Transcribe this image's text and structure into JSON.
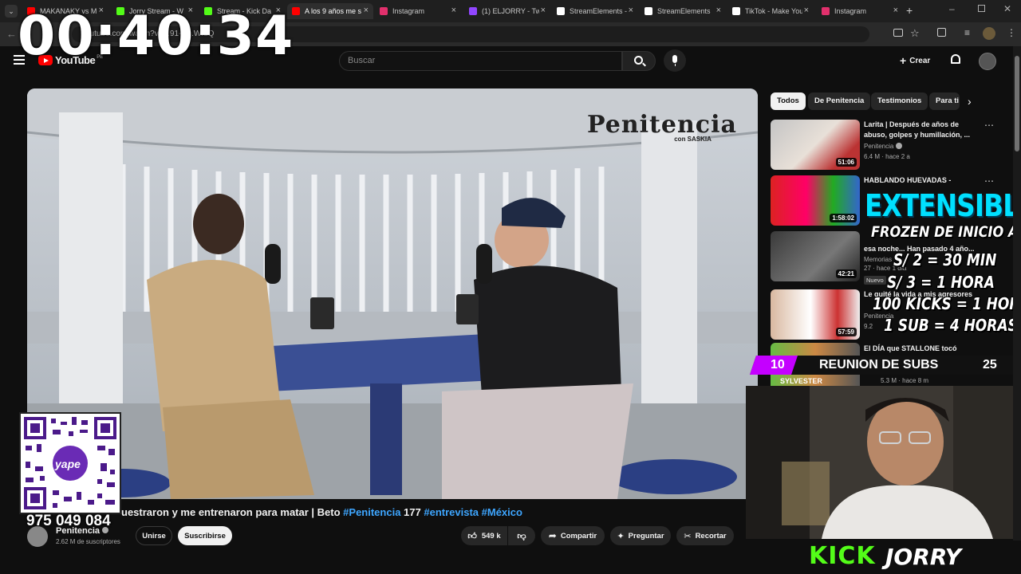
{
  "browser": {
    "tabs": [
      {
        "title": "MAKANAKY vs M",
        "fav_color": "#ff0000",
        "active": false
      },
      {
        "title": "Jorry Stream - W",
        "fav_color": "#53fc18",
        "active": false
      },
      {
        "title": "Stream - Kick Da",
        "fav_color": "#53fc18",
        "active": false
      },
      {
        "title": "A los 9 años me s",
        "fav_color": "#ff0000",
        "active": true
      },
      {
        "title": "Instagram",
        "fav_color": "#e1306c",
        "active": false
      },
      {
        "title": "(1) ELJORRY - Twi",
        "fav_color": "#9146ff",
        "active": false
      },
      {
        "title": "StreamElements -",
        "fav_color": "#ffffff",
        "active": false
      },
      {
        "title": "StreamElements",
        "fav_color": "#ffffff",
        "active": false
      },
      {
        "title": "TikTok - Make You",
        "fav_color": "#ffffff",
        "active": false
      },
      {
        "title": "Instagram",
        "fav_color": "#e1306c",
        "active": false
      }
    ],
    "url": "youtube.com/watch?v=...91-H...WfdQ"
  },
  "youtube": {
    "logo_text": "YouTube",
    "region": "PE",
    "search_placeholder": "Buscar",
    "create_label": "Crear"
  },
  "video": {
    "watermark": "Penitencia",
    "watermark_sub": "con SASKIA",
    "title_prefix": "uestraron y me entrenaron para matar | Beto ",
    "tag1": "#Penitencia",
    "title_num": " 177 ",
    "tag2": "#entrevista",
    "tag3": "#México",
    "channel_name": "Penitencia",
    "subscribers": "2.62 M de suscriptores",
    "join_label": "Unirse",
    "subscribe_label": "Suscribirse",
    "likes": "549 k",
    "share_label": "Compartir",
    "ask_label": "Preguntar",
    "clip_label": "Recortar"
  },
  "sidebar": {
    "chips": [
      "Todos",
      "De Penitencia",
      "Testimonios",
      "Para ti"
    ],
    "recommendations": [
      {
        "title": "Larita | Después de años de abuso, golpes y humillación, ...",
        "channel": "Penitencia",
        "meta": "6.4 M · hace 2 a",
        "duration": "51:06"
      },
      {
        "title": "HABLANDO HUEVADAS -",
        "channel": "",
        "meta": "",
        "duration": "1:58:02"
      },
      {
        "title": "esa noche... Han pasado 4 año...",
        "channel": "Memorias",
        "meta": "27 · hace 1 día",
        "duration": "42:21",
        "badge": "Nuevo"
      },
      {
        "title": "Le quité la vida a mis agresores",
        "channel": "Penitencia",
        "meta": "9.2",
        "duration": "57:59"
      },
      {
        "title": "El DÍA que STALLONE tocó",
        "channel": "",
        "meta": "5.3 M · hace 8 m",
        "duration": ""
      }
    ]
  },
  "overlay": {
    "timer": "00:40:34",
    "phone": "975 049 084",
    "qr_label": "yape",
    "extensible_title": "EXTENSIBLE",
    "ext_lines": [
      "FROZEN DE INICIO A FIN",
      "S/ 2 = 30 MIN",
      "S/ 3  = 1 HORA",
      "100 KICKS = 1 HORA",
      "1 SUB = 4 HORAS"
    ],
    "subs_current": "10",
    "subs_label": "REUNION DE SUBS",
    "subs_goal": "25",
    "sylvester_label": "SYLVESTER",
    "kick_label": "KICK",
    "streamer_name": "JORRY"
  },
  "colors": {
    "kick_green": "#53fc18",
    "extensible_cyan": "#00e0ff",
    "subs_purple": "#c400ff",
    "yt_link_blue": "#3ea6ff",
    "yt_red": "#ff0000"
  }
}
